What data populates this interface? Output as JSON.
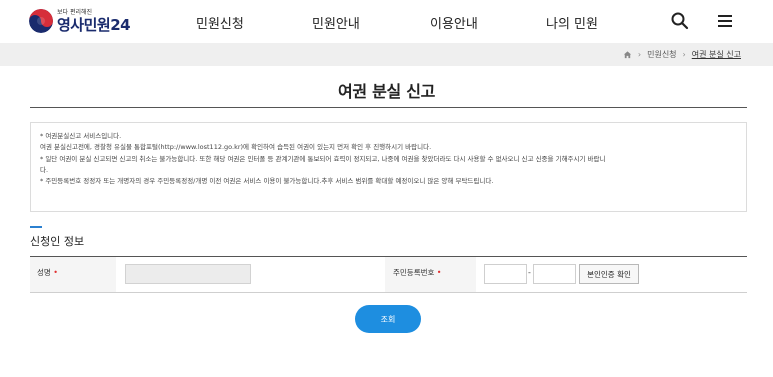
{
  "header": {
    "logo_sub": "보다 편리해진",
    "logo_main": "영사민원24",
    "nav": [
      "민원신청",
      "민원안내",
      "이용안내",
      "나의 민원"
    ],
    "search_icon": "search-icon",
    "menu_icon": "hamburger-menu-icon"
  },
  "breadcrumb": {
    "home_icon": "home-icon",
    "items": [
      "민원신청",
      "여권 분실 신고"
    ]
  },
  "page": {
    "title": "여권 분실 신고"
  },
  "notice": {
    "lines": [
      "* 여권분실신고 서비스입니다.",
      "  여권 분실신고전에, 경찰청 유실물 통합포털(http://www.lost112.go.kr)에 확인하여 습득된 여권이 있는지 먼저 확인 후 진행하시기 바랍니다.",
      "* 일단 여권이 분실 신고되면 신고의 취소는 불가능합니다. 또한 해당 여권은 인터폴 등 관계기관에 통보되어 효력이 정지되고, 나중에 여권을 찾았더라도 다시 사용할 수 없사오니 신고 신중을 기해주시기 바랍니",
      "  다.",
      "* 주민등록번호 정정자 또는 개명자의 경우 주민등록정정/개명 이전 여권은 서비스 이용이 불가능합니다.추후 서비스 범위를 확대할 예정이오니 많은 양해 부탁드립니다."
    ]
  },
  "applicant": {
    "section_title": "신청인 정보",
    "name_label": "성명",
    "rrn_label": "주민등록번호",
    "required_mark": "•",
    "dash": "-",
    "verify_label": "본인인증 확인",
    "name_value": "",
    "rrn_front_value": "",
    "rrn_back_value": ""
  },
  "actions": {
    "submit_label": "조회"
  },
  "colors": {
    "brand_navy": "#1a2b6d",
    "accent_blue": "#1e8ee0",
    "required_red": "#e03030"
  }
}
